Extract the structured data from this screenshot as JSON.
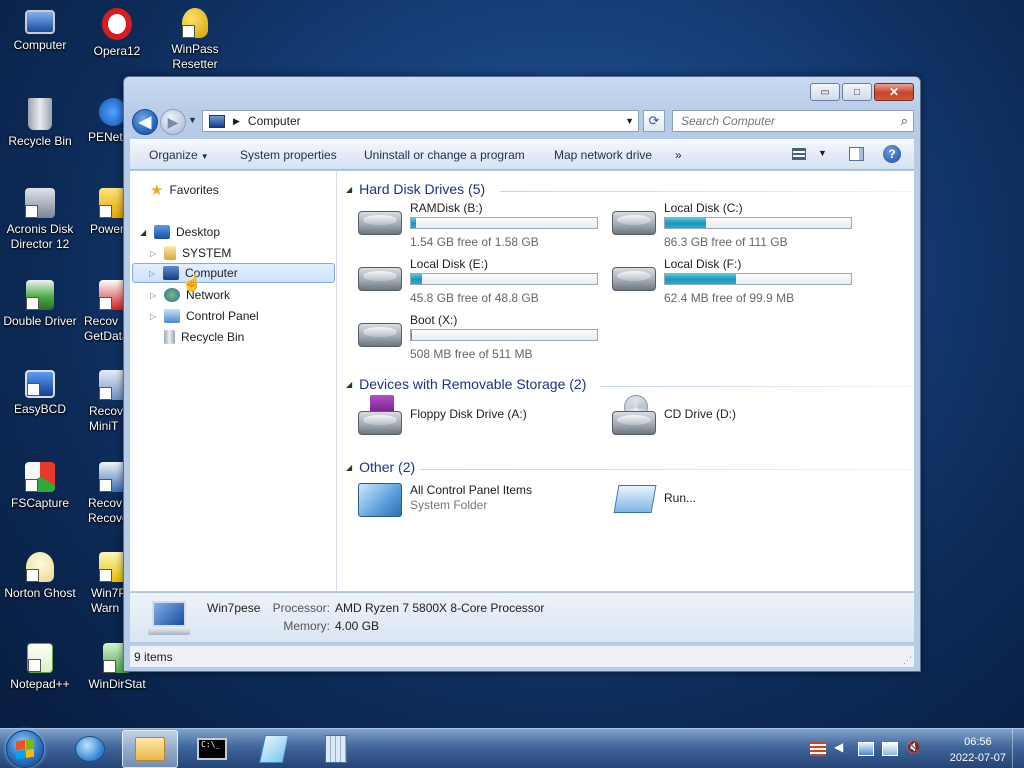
{
  "desktop": {
    "icons": [
      {
        "label": "Computer"
      },
      {
        "label": "Opera12"
      },
      {
        "label": "WinPass Resetter"
      },
      {
        "label": "Recycle Bin"
      },
      {
        "label": "PENet"
      },
      {
        "label": "Acronis Disk Director 12"
      },
      {
        "label": "Power"
      },
      {
        "label": "Double Driver"
      },
      {
        "label": "Recov GetData"
      },
      {
        "label": "EasyBCD"
      },
      {
        "label": "Recov MiniT"
      },
      {
        "label": "FSCapture"
      },
      {
        "label": "Recov Recove"
      },
      {
        "label": "Norton Ghost"
      },
      {
        "label": "Win7P Warn"
      },
      {
        "label": "Notepad++"
      },
      {
        "label": "WinDirStat"
      }
    ]
  },
  "window": {
    "caption_buttons": {
      "minimize": "▭",
      "maximize": "□",
      "close": "✕"
    },
    "address": {
      "breadcrumb": "Computer"
    },
    "search": {
      "placeholder": "Search Computer"
    },
    "toolbar": {
      "organize": "Organize",
      "system_properties": "System properties",
      "uninstall": "Uninstall or change a program",
      "map_drive": "Map network drive",
      "more": "»",
      "help": "?"
    },
    "nav": {
      "favorites": "Favorites",
      "desktop": "Desktop",
      "system": "SYSTEM",
      "computer": "Computer",
      "network": "Network",
      "control_panel": "Control Panel",
      "recycle_bin": "Recycle Bin"
    },
    "groups": {
      "hard_disk": "Hard Disk Drives (5)",
      "removable": "Devices with Removable Storage (2)",
      "other": "Other (2)"
    },
    "drives": [
      {
        "name": "RAMDisk (B:)",
        "free": "1.54 GB free of 1.58 GB",
        "used_fraction": 0.025
      },
      {
        "name": "Local Disk (C:)",
        "free": "86.3 GB free of 111 GB",
        "used_fraction": 0.22
      },
      {
        "name": "Local Disk (E:)",
        "free": "45.8 GB free of 48.8 GB",
        "used_fraction": 0.06
      },
      {
        "name": "Local Disk (F:)",
        "free": "62.4 MB free of 99.9 MB",
        "used_fraction": 0.38
      },
      {
        "name": "Boot (X:)",
        "free": "508 MB free of 511 MB",
        "used_fraction": 0.006
      }
    ],
    "removable": [
      {
        "name": "Floppy Disk Drive (A:)"
      },
      {
        "name": "CD Drive (D:)"
      }
    ],
    "other": [
      {
        "name": "All Control Panel Items",
        "sub": "System Folder"
      },
      {
        "name": "Run..."
      }
    ],
    "details": {
      "computer_name": "Win7pese",
      "processor_label": "Processor:",
      "processor_value": "AMD Ryzen 7 5800X 8-Core Processor",
      "memory_label": "Memory:",
      "memory_value": "4.00 GB"
    },
    "status": {
      "items": "9 items"
    }
  },
  "taskbar": {
    "clock_time": "06:56",
    "clock_date": "2022-07-07"
  },
  "colors": {
    "accent": "#1e3287",
    "drive_bar": "#1e97b9"
  }
}
